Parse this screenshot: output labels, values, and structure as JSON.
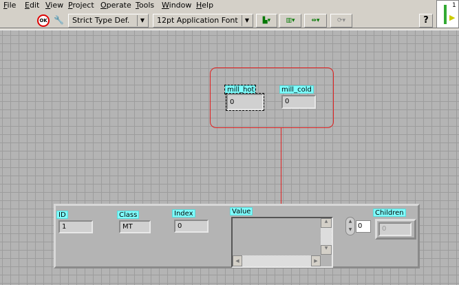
{
  "menu": [
    "File",
    "Edit",
    "View",
    "Project",
    "Operate",
    "Tools",
    "Window",
    "Help"
  ],
  "toolbar": {
    "type_def": "Strict Type Def.",
    "font": "12pt Application Font",
    "help": "?",
    "icon_number": "1"
  },
  "controls": {
    "mill_hot": {
      "label": "mill_hot",
      "value": "0"
    },
    "mill_cold": {
      "label": "mill_cold",
      "value": "0"
    }
  },
  "cluster": {
    "id": {
      "label": "ID",
      "value": "1"
    },
    "class": {
      "label": "Class",
      "value": "MT"
    },
    "index": {
      "label": "Index",
      "value": "0"
    },
    "value": {
      "label": "Value"
    },
    "array_index": "0",
    "children": {
      "label": "Children",
      "value": "0"
    }
  },
  "colors": {
    "label_bg": "#7fffff",
    "highlight": "#e02020"
  }
}
